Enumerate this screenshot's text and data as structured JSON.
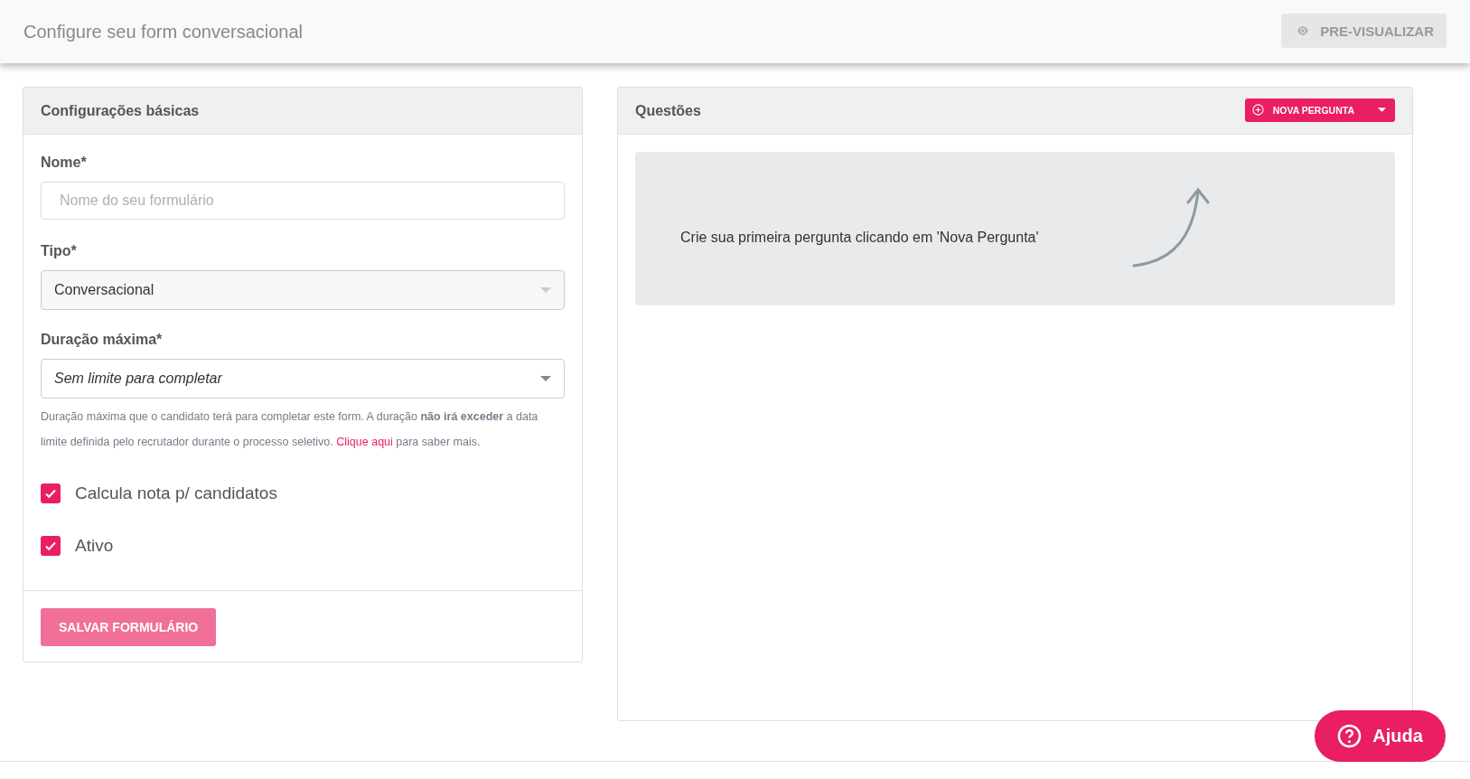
{
  "header": {
    "title": "Configure seu form conversacional",
    "preview_button": {
      "label": "PRE-VISUALIZAR",
      "disabled": true
    }
  },
  "basic": {
    "title": "Configurações básicas",
    "name_field": {
      "label": "Nome*",
      "placeholder": "Nome do seu formulário"
    },
    "type_field": {
      "label": "Tipo*",
      "value": "Conversacional",
      "disabled": true
    },
    "duration_field": {
      "label": "Duração máxima*",
      "value": "Sem limite para completar"
    },
    "help": {
      "text": "Duração máxima que o candidato terá para completar este form. A duração **não irá exceder** a data limite definida pelo recrutador durante o processo seletivo.",
      "link": "Clique aqui",
      "after": "para saber mais."
    },
    "checkboxes": [
      {
        "label": "Calcula nota p/ candidatos",
        "checked": true
      },
      {
        "label": "Ativo",
        "checked": true
      }
    ],
    "save_button": {
      "label": "SALVAR FORMULÁRIO",
      "disabled": true
    }
  },
  "questions": {
    "title": "Questões",
    "new_button": {
      "label": "NOVA PERGUNTA"
    },
    "empty_message": "Crie sua primeira pergunta clicando em 'Nova Pergunta'"
  },
  "help_button": {
    "label": "Ajuda"
  }
}
